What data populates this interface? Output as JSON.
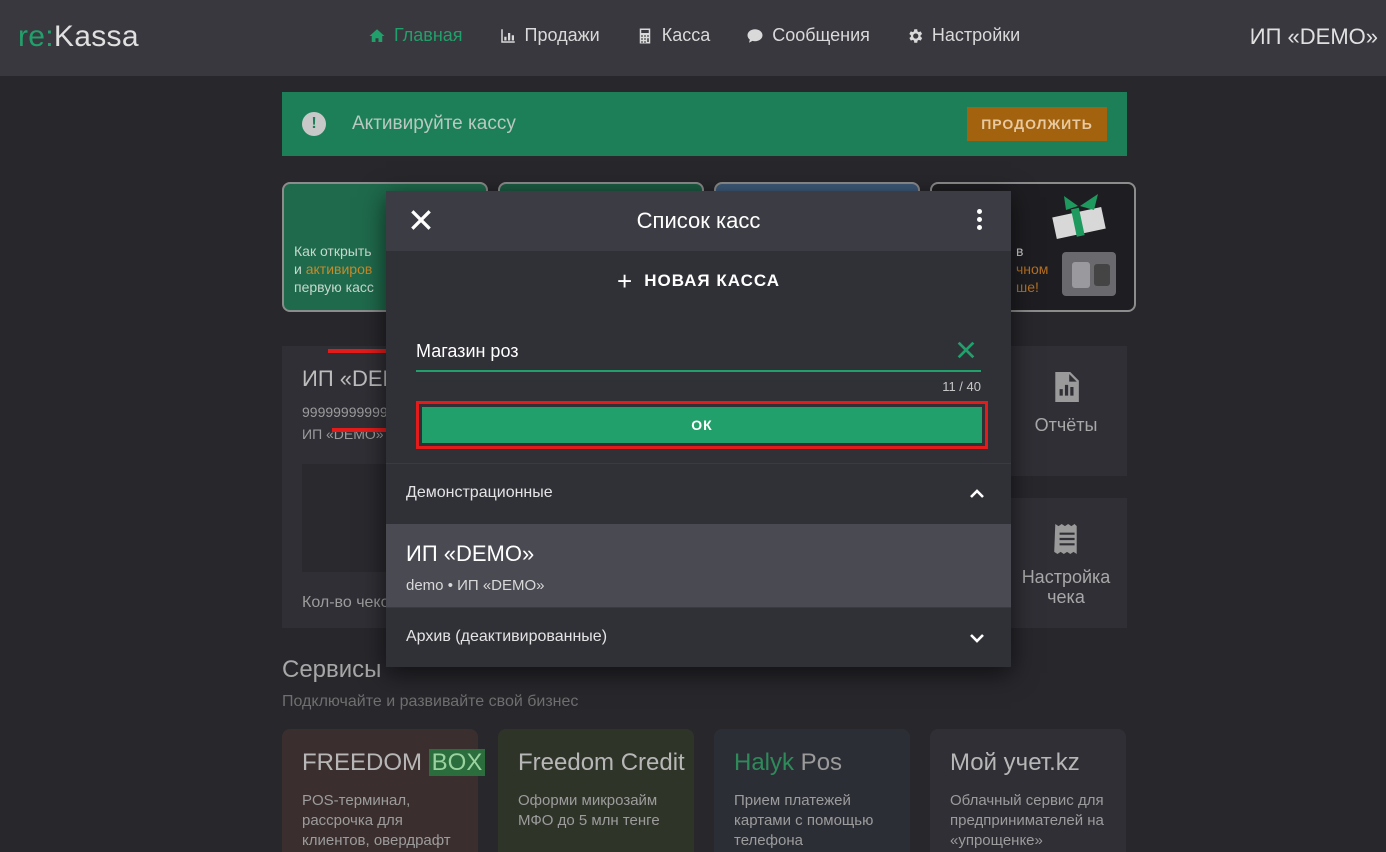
{
  "app": {
    "logo_prefix": "re:",
    "logo_name": "Kassa",
    "account_name": "ИП «DEMO»",
    "accent_color": "#22a06b"
  },
  "nav": {
    "items": [
      {
        "label": "Главная",
        "icon": "home-icon",
        "active": true
      },
      {
        "label": "Продажи",
        "icon": "sales-chart-icon",
        "active": false
      },
      {
        "label": "Касса",
        "icon": "calculator-icon",
        "active": false
      },
      {
        "label": "Сообщения",
        "icon": "chat-icon",
        "active": false
      },
      {
        "label": "Настройки",
        "icon": "gear-icon",
        "active": false
      }
    ]
  },
  "banner": {
    "text": "Активируйте кассу",
    "button_label": "ПРОДОЛЖИТЬ"
  },
  "promo_cards": {
    "card1_line1": "Как открыть",
    "card1_line2_prefix": "и ",
    "card1_line2_highlight": "активиров",
    "card1_line3": "первую касс",
    "card4_line1": "в",
    "card4_line2": "чном",
    "card4_line3": "ше!"
  },
  "dashboard": {
    "org_name": "ИП «DEM",
    "org_id": "99999999999",
    "org_subname": "ИП «DEMO»",
    "checks_count_label": "Кол-во чеко",
    "reports_label": "Отчёты",
    "receipt_settings_line1": "Настройка",
    "receipt_settings_line2": "чека"
  },
  "services": {
    "title": "Сервисы",
    "subtitle": "Подключайте и развивайте свой бизнес",
    "items": [
      {
        "name": "FREEDOM ",
        "name_tag": "BOX",
        "desc": "POS-терминал, рассрочка для клиентов, овердрафт"
      },
      {
        "name": "Freedom Credit",
        "desc": "Оформи микрозайм МФО до 5 млн тенге"
      },
      {
        "name": "Halyk",
        "name_suffix": " Pos",
        "desc": "Прием платежей картами с помощью телефона"
      },
      {
        "name": "Мой учет.kz",
        "desc": "Облачный сервис для предпринимателей на «упрощенке»"
      }
    ]
  },
  "modal": {
    "title": "Список касс",
    "new_label": "НОВАЯ КАССА",
    "input_value": "Магазин роз",
    "counter": "11 / 40",
    "ok_label": "ОК",
    "section_demo": "Демонстрационные",
    "item_name": "ИП «DEMO»",
    "item_sub": "demo • ИП «DEMO»",
    "section_archive": "Архив (деактивированные)"
  }
}
